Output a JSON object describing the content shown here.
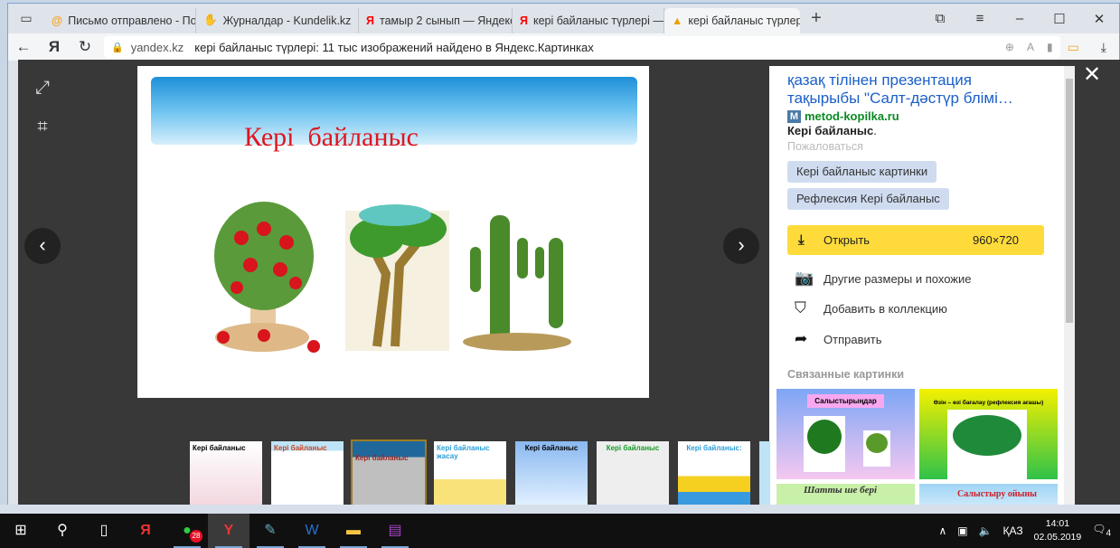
{
  "browser": {
    "tabs": [
      {
        "label": "Письмо отправлено - По",
        "icon": "mail-icon",
        "active": false
      },
      {
        "label": "Журналдар - Kundelik.kz",
        "icon": "kundelik-icon",
        "active": false
      },
      {
        "label": "тамыр 2 сынып — Яндекс",
        "icon": "yandex-icon",
        "active": false
      },
      {
        "label": "кері байланыс түрлері —",
        "icon": "yandex-icon",
        "active": false
      },
      {
        "label": "кері байланыс түрлері:",
        "icon": "images-icon",
        "active": true
      }
    ],
    "address": {
      "host": "yandex.kz",
      "title": "кері байланыс түрлері: 11 тыс изображений найдено в Яндекс.Картинках"
    }
  },
  "viewer": {
    "slide": {
      "title": "Кері  байланыс"
    },
    "panel": {
      "title": "қазақ тілінен презентация тақырыбы \"Салт-дәстүр блімі…",
      "site_icon": "M",
      "site": "metod-kopilka.ru",
      "description": "Кері байланыс",
      "description_suffix": ".",
      "report": "Пожаловаться",
      "chips": [
        "Кері байланыс картинки",
        "Рефлексия Кері байланыс"
      ],
      "open_label": "Открыть",
      "open_size": "960×720",
      "actions": [
        "Другие размеры и похожие",
        "Добавить в коллекцию",
        "Отправить"
      ],
      "related_title": "Связанные картинки",
      "related": [
        "Салыстырыңдар",
        "Өзін – өзі бағалау (рефлексия ағашы)",
        "Шатты ше бері",
        "Салыстыру ойыны"
      ]
    },
    "thumbnails": [
      "Кері байланыс",
      "Кері байланыс",
      "Кері байланыс",
      "Кері байланыс жасау",
      "Кері байланыс",
      "Кері байланыс",
      "Кері байланыс:",
      ""
    ],
    "selected_thumbnail": 2
  },
  "taskbar": {
    "whatsapp_badge": "28",
    "language": "ҚАЗ",
    "time": "14:01",
    "date": "02.05.2019",
    "notifications": "4"
  },
  "colors": {
    "open_button": "#fedb3b",
    "link": "#1a5fc8",
    "site": "#0b8a24",
    "viewer_bg": "#383838"
  }
}
